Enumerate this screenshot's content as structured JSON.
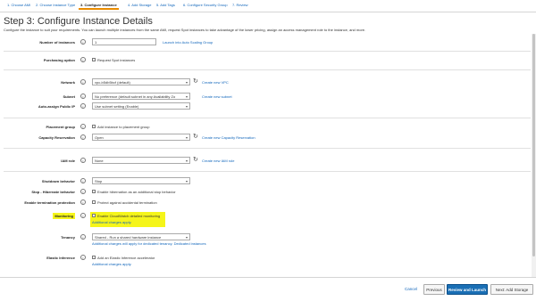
{
  "steps": [
    {
      "label": "1. Choose AMI"
    },
    {
      "label": "2. Choose Instance Type"
    },
    {
      "label": "3. Configure Instance"
    },
    {
      "label": "4. Add Storage"
    },
    {
      "label": "5. Add Tags"
    },
    {
      "label": "6. Configure Security Group"
    },
    {
      "label": "7. Review"
    }
  ],
  "active_step": 2,
  "page": {
    "title": "Step 3: Configure Instance Details",
    "description": "Configure the instance to suit your requirements. You can launch multiple instances from the same AMI, request Spot instances to take advantage of the lower pricing, assign an access management role to the instance, and more."
  },
  "fields": {
    "instances": {
      "label": "Number of instances",
      "value": "1",
      "link": "Launch into Auto Scaling Group"
    },
    "purchasing": {
      "label": "Purchasing option",
      "checkbox": "Request Spot instances"
    },
    "network": {
      "label": "Network",
      "value": "vpc-b5db5bcf (default)",
      "link": "Create new VPC"
    },
    "subnet": {
      "label": "Subnet",
      "value": "No preference (default subnet in any Availability Zo",
      "link": "Create new subnet"
    },
    "public_ip": {
      "label": "Auto-assign Public IP",
      "value": "Use subnet setting (Enable)"
    },
    "placement": {
      "label": "Placement group",
      "checkbox": "Add instance to placement group"
    },
    "capacity": {
      "label": "Capacity Reservation",
      "value": "Open",
      "link": "Create new Capacity Reservation"
    },
    "iam": {
      "label": "IAM role",
      "value": "None",
      "link": "Create new IAM role"
    },
    "shutdown": {
      "label": "Shutdown behavior",
      "value": "Stop"
    },
    "hibernate": {
      "label": "Stop - Hibernate behavior",
      "checkbox": "Enable hibernation as an additional stop behavior"
    },
    "termination": {
      "label": "Enable termination protection",
      "checkbox": "Protect against accidental termination"
    },
    "monitoring": {
      "label": "Monitoring",
      "checkbox": "Enable CloudWatch detailed monitoring",
      "note": "Additional charges apply."
    },
    "tenancy": {
      "label": "Tenancy",
      "value": "Shared - Run a shared hardware instance",
      "note": "Additional charges will apply for dedicated tenancy.",
      "note_link": "Dedicated instances"
    },
    "elastic": {
      "label": "Elastic Inference",
      "checkbox": "Add an Elastic Inference accelerator",
      "note": "Additional charges apply."
    }
  },
  "footer": {
    "cancel": "Cancel",
    "previous": "Previous",
    "review": "Review and Launch",
    "next": "Next: Add Storage"
  },
  "colors": {
    "link": "#1166bb",
    "highlight": "#f5f51a",
    "primary_button": "#1a6fb5",
    "active_step_underline": "#e98b00"
  }
}
